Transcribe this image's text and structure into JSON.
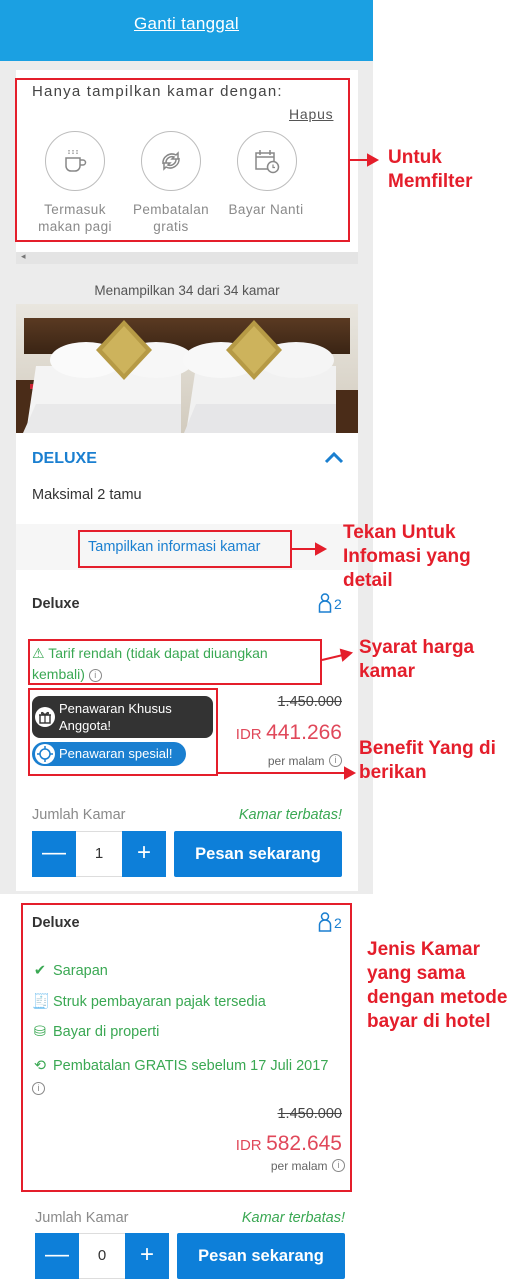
{
  "header": {
    "change_date": "Ganti tanggal"
  },
  "filter": {
    "title": "Hanya tampilkan kamar dengan:",
    "clear": "Hapus",
    "options": [
      {
        "label": "Termasuk makan pagi",
        "icon": "coffee-icon"
      },
      {
        "label": "Pembatalan gratis",
        "icon": "free-cancel-icon"
      },
      {
        "label": "Bayar Nanti",
        "icon": "calendar-clock-icon"
      }
    ]
  },
  "listing": {
    "count_text": "Menampilkan 34 dari 34 kamar"
  },
  "room": {
    "name": "DELUXE",
    "max_guests": "Maksimal 2 tamu",
    "info_link": "Tampilkan informasi kamar"
  },
  "offer1": {
    "title": "Deluxe",
    "guests": "2",
    "rate_note": "Tarif rendah (tidak dapat diuangkan kembali)",
    "badge_member": "Penawaran Khusus Anggota!",
    "badge_special": "Penawaran spesial!",
    "original_price": "1.450.000",
    "currency": "IDR",
    "price": "441.266",
    "per_night": "per malam",
    "qty_label": "Jumlah Kamar",
    "limited": "Kamar terbatas!",
    "qty": "1",
    "minus": "—",
    "plus": "+",
    "book": "Pesan sekarang"
  },
  "offer2": {
    "title": "Deluxe",
    "guests": "2",
    "benefits": [
      {
        "text": "Sarapan",
        "icon": "check-icon"
      },
      {
        "text": "Struk pembayaran pajak tersedia",
        "icon": "receipt-icon"
      },
      {
        "text": "Bayar di properti",
        "icon": "pay-at-property-icon"
      },
      {
        "text": "Pembatalan GRATIS sebelum 17 Juli 2017",
        "icon": "free-cancel-icon"
      }
    ],
    "original_price": "1.450.000",
    "currency": "IDR",
    "price": "582.645",
    "per_night": "per malam",
    "qty_label": "Jumlah Kamar",
    "limited": "Kamar terbatas!",
    "qty": "0",
    "minus": "—",
    "plus": "+",
    "book": "Pesan sekarang"
  },
  "annotations": {
    "filter": "Untuk Memfilter",
    "info": "Tekan Untuk Infomasi yang detail",
    "rate": "Syarat harga kamar",
    "benefit": "Benefit Yang di berikan",
    "same_room": "Jenis Kamar yang sama dengan metode bayar di hotel"
  },
  "colors": {
    "primary": "#0d7fd9",
    "header": "#1ba0e2",
    "price": "#e0485a",
    "benefit": "#3aa853",
    "annotation": "#e41e2b"
  }
}
